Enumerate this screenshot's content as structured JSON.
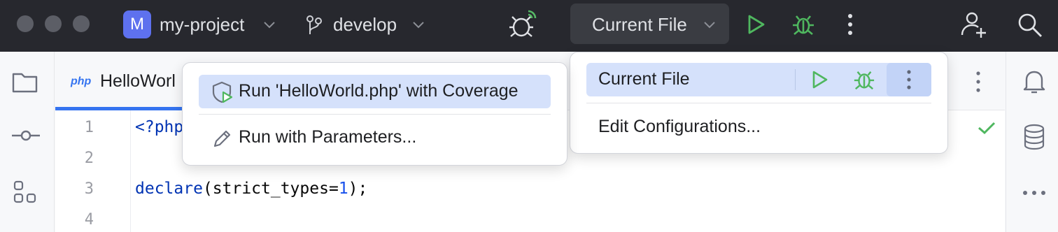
{
  "titlebar": {
    "project_initial": "M",
    "project_name": "my-project",
    "branch": "develop",
    "run_config": "Current File"
  },
  "editor": {
    "file_badge": "php",
    "tab_title": "HelloWorl",
    "line_numbers": [
      "1",
      "2",
      "3",
      "4"
    ],
    "code_line1": "<?php",
    "code_line3_kw": "declare",
    "code_line3_a": "(strict_types=",
    "code_line3_num": "1",
    "code_line3_b": ");"
  },
  "run_widget_menu": {
    "selected_item": "Current File",
    "edit_configs": "Edit Configurations..."
  },
  "more_actions_menu": {
    "coverage": "Run 'HelloWorld.php' with Coverage",
    "parameters": "Run with Parameters..."
  },
  "colors": {
    "titlebar": "#27282e",
    "run_green": "#4fb75f",
    "accent_blue": "#3574f0",
    "selection": "#d5e1fb"
  },
  "icons": [
    "folder-icon",
    "commit-icon",
    "structure-icon",
    "bell-icon",
    "database-icon",
    "more-icon",
    "branch-icon",
    "bug-icon",
    "run-icon",
    "add-user-icon",
    "search-icon",
    "coverage-icon",
    "pencil-icon",
    "check-icon"
  ]
}
